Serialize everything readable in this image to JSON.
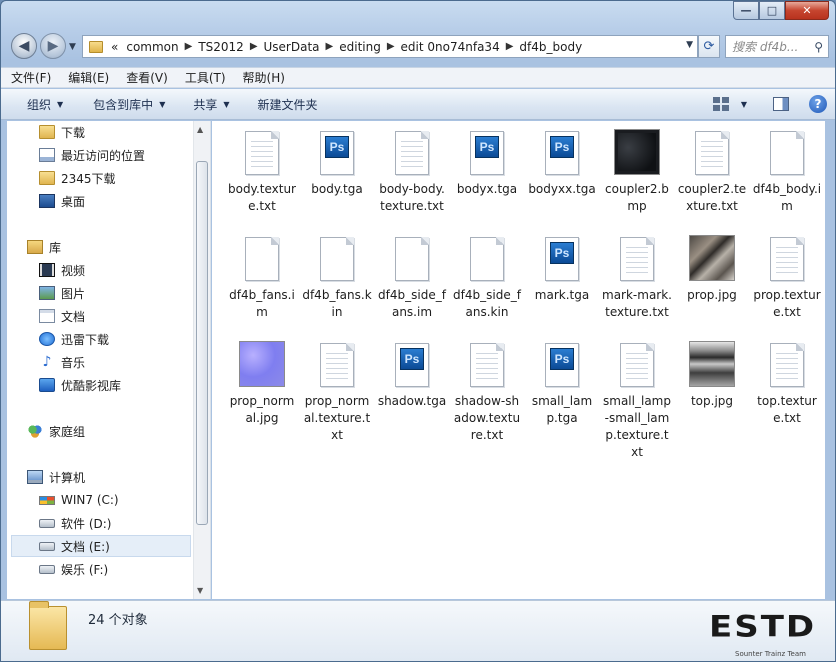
{
  "window": {
    "caption": {
      "minimize": "—",
      "maximize": "□",
      "close": "✕"
    }
  },
  "address_bar": {
    "overflow": "«",
    "crumbs": [
      "common",
      "TS2012",
      "UserData",
      "editing",
      "edit 0no74nfa34",
      "df4b_body"
    ]
  },
  "search": {
    "placeholder": "搜索 df4b..."
  },
  "menu": [
    "文件(F)",
    "编辑(E)",
    "查看(V)",
    "工具(T)",
    "帮助(H)"
  ],
  "commands": {
    "organize": "组织",
    "include_library": "包含到库中",
    "share": "共享",
    "new_folder": "新建文件夹"
  },
  "nav": {
    "favorites": [
      {
        "label": "下载",
        "icon": "folder-icon"
      },
      {
        "label": "最近访问的位置",
        "icon": "recent-places-icon"
      },
      {
        "label": "2345下载",
        "icon": "folder-icon"
      },
      {
        "label": "桌面",
        "icon": "desktop-icon"
      }
    ],
    "libraries_label": "库",
    "libraries": [
      {
        "label": "视频",
        "icon": "video-icon"
      },
      {
        "label": "图片",
        "icon": "picture-icon"
      },
      {
        "label": "文档",
        "icon": "document-icon"
      },
      {
        "label": "迅雷下载",
        "icon": "thunder-icon"
      },
      {
        "label": "音乐",
        "icon": "music-icon"
      },
      {
        "label": "优酷影视库",
        "icon": "youku-icon"
      }
    ],
    "homegroup_label": "家庭组",
    "computer_label": "计算机",
    "drives": [
      {
        "label": "WIN7 (C:)",
        "icon": "windows-drive-icon"
      },
      {
        "label": "软件 (D:)",
        "icon": "drive-icon"
      },
      {
        "label": "文档 (E:)",
        "icon": "drive-icon",
        "selected": true
      },
      {
        "label": "娱乐 (F:)",
        "icon": "drive-icon"
      }
    ]
  },
  "files": [
    {
      "name": "body.texture.txt",
      "type": "text"
    },
    {
      "name": "body.tga",
      "type": "ps"
    },
    {
      "name": "body-body.texture.txt",
      "type": "text"
    },
    {
      "name": "bodyx.tga",
      "type": "ps"
    },
    {
      "name": "bodyxx.tga",
      "type": "ps"
    },
    {
      "name": "coupler2.bmp",
      "type": "thumb-dark"
    },
    {
      "name": "coupler2.texture.txt",
      "type": "text"
    },
    {
      "name": "df4b_body.im",
      "type": "blank"
    },
    {
      "name": "df4b_fans.im",
      "type": "blank"
    },
    {
      "name": "df4b_fans.kin",
      "type": "blank"
    },
    {
      "name": "df4b_side_fans.im",
      "type": "blank"
    },
    {
      "name": "df4b_side_fans.kin",
      "type": "blank"
    },
    {
      "name": "mark.tga",
      "type": "ps"
    },
    {
      "name": "mark-mark.texture.txt",
      "type": "text"
    },
    {
      "name": "prop.jpg",
      "type": "thumb-prop"
    },
    {
      "name": "prop.texture.txt",
      "type": "text"
    },
    {
      "name": "prop_normal.jpg",
      "type": "thumb-normal"
    },
    {
      "name": "prop_normal.texture.txt",
      "type": "text"
    },
    {
      "name": "shadow.tga",
      "type": "ps"
    },
    {
      "name": "shadow-shadow.texture.txt",
      "type": "text"
    },
    {
      "name": "small_lamp.tga",
      "type": "ps"
    },
    {
      "name": "small_lamp-small_lamp.texture.txt",
      "type": "text"
    },
    {
      "name": "top.jpg",
      "type": "thumb-top"
    },
    {
      "name": "top.texture.txt",
      "type": "text"
    }
  ],
  "status": {
    "count_text": "24 个对象"
  },
  "watermark": {
    "letters": "ESTD",
    "tagline": "Sounter Trainz Team"
  }
}
